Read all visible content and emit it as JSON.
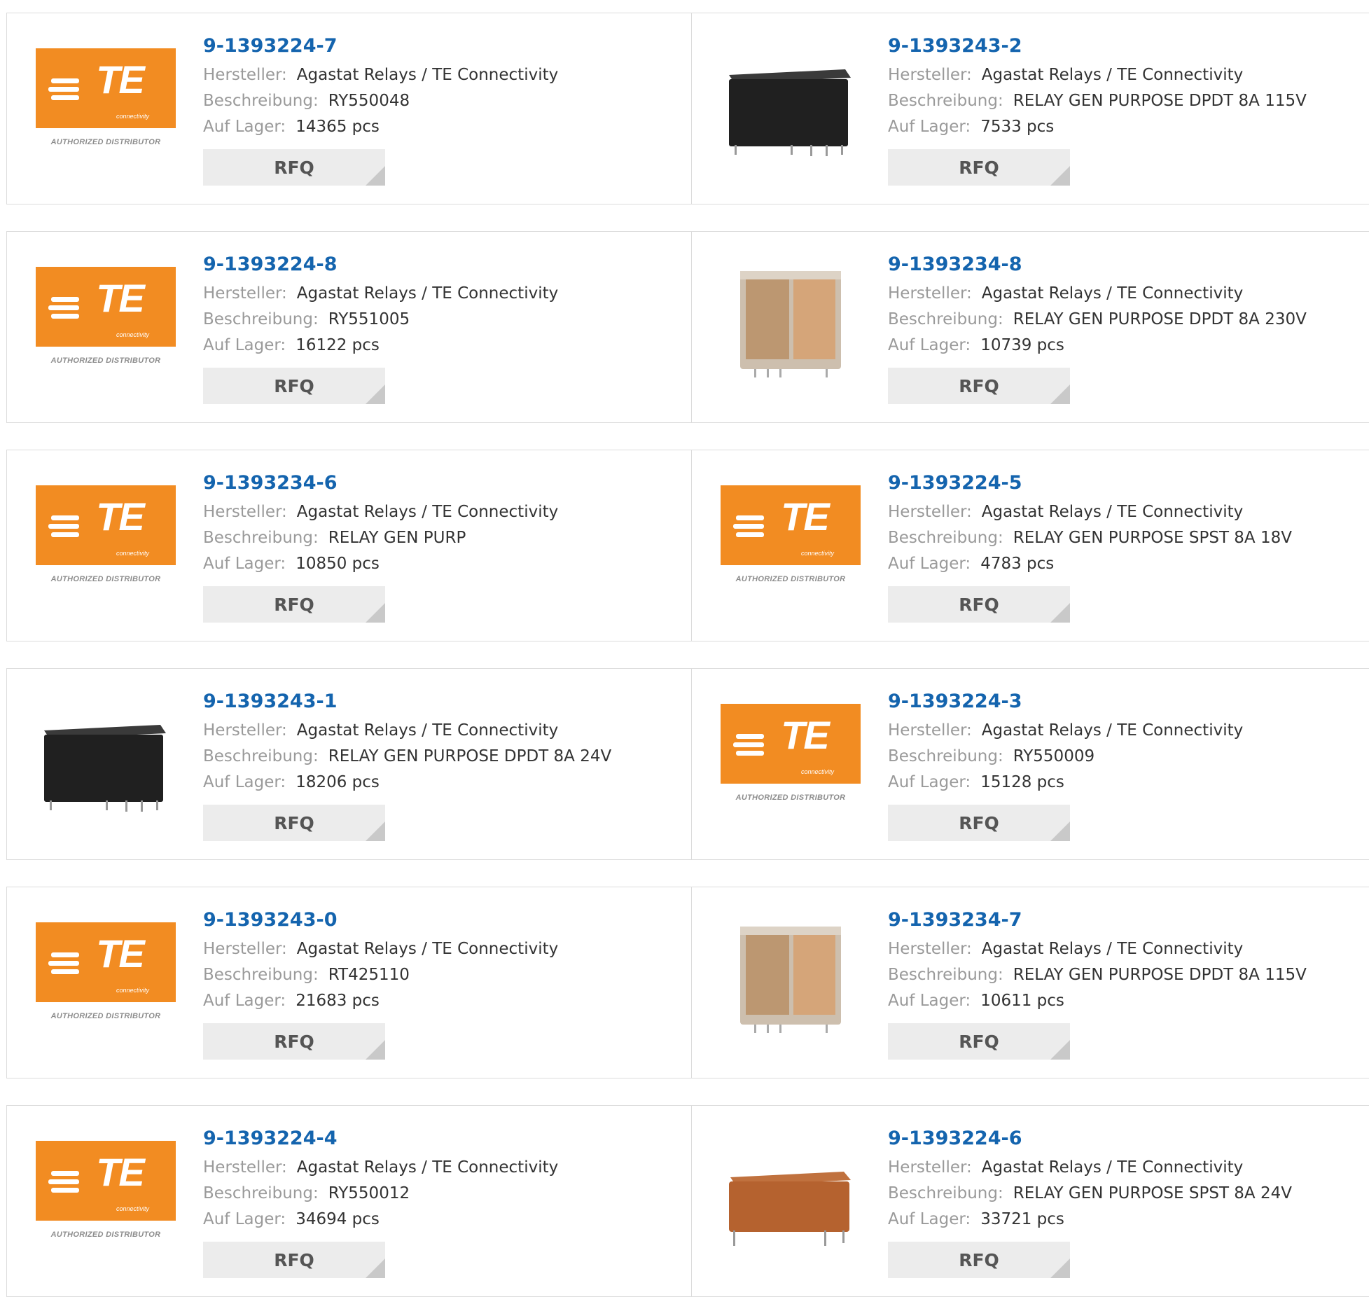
{
  "labels": {
    "manufacturer": "Hersteller:",
    "description": "Beschreibung:",
    "stock": "Auf Lager:",
    "rfq": "RFQ"
  },
  "logo": {
    "brand": "TE",
    "sub": "connectivity",
    "tagline": "AUTHORIZED DISTRIBUTOR",
    "color": "#f28c22"
  },
  "link_color": "#1464ae",
  "products": [
    {
      "pn": "9-1393224-7",
      "manufacturer": "Agastat Relays / TE Connectivity",
      "description": "RY550048",
      "stock": "14365 pcs",
      "image": "te-logo"
    },
    {
      "pn": "9-1393243-2",
      "manufacturer": "Agastat Relays / TE Connectivity",
      "description": "RELAY GEN PURPOSE DPDT 8A 115V",
      "stock": "7533 pcs",
      "image": "black-relay"
    },
    {
      "pn": "9-1393224-8",
      "manufacturer": "Agastat Relays / TE Connectivity",
      "description": "RY551005",
      "stock": "16122 pcs",
      "image": "te-logo"
    },
    {
      "pn": "9-1393234-8",
      "manufacturer": "Agastat Relays / TE Connectivity",
      "description": "RELAY GEN PURPOSE DPDT 8A 230V",
      "stock": "10739 pcs",
      "image": "clear-relay"
    },
    {
      "pn": "9-1393234-6",
      "manufacturer": "Agastat Relays / TE Connectivity",
      "description": "RELAY GEN PURP",
      "stock": "10850 pcs",
      "image": "te-logo"
    },
    {
      "pn": "9-1393224-5",
      "manufacturer": "Agastat Relays / TE Connectivity",
      "description": "RELAY GEN PURPOSE SPST 8A 18V",
      "stock": "4783 pcs",
      "image": "te-logo"
    },
    {
      "pn": "9-1393243-1",
      "manufacturer": "Agastat Relays / TE Connectivity",
      "description": "RELAY GEN PURPOSE DPDT 8A 24V",
      "stock": "18206 pcs",
      "image": "black-relay"
    },
    {
      "pn": "9-1393224-3",
      "manufacturer": "Agastat Relays / TE Connectivity",
      "description": "RY550009",
      "stock": "15128 pcs",
      "image": "te-logo"
    },
    {
      "pn": "9-1393243-0",
      "manufacturer": "Agastat Relays / TE Connectivity",
      "description": "RT425110",
      "stock": "21683 pcs",
      "image": "te-logo"
    },
    {
      "pn": "9-1393234-7",
      "manufacturer": "Agastat Relays / TE Connectivity",
      "description": "RELAY GEN PURPOSE DPDT 8A 115V",
      "stock": "10611 pcs",
      "image": "clear-relay"
    },
    {
      "pn": "9-1393224-4",
      "manufacturer": "Agastat Relays / TE Connectivity",
      "description": "RY550012",
      "stock": "34694 pcs",
      "image": "te-logo"
    },
    {
      "pn": "9-1393224-6",
      "manufacturer": "Agastat Relays / TE Connectivity",
      "description": "RELAY GEN PURPOSE SPST 8A 24V",
      "stock": "33721 pcs",
      "image": "brown-relay"
    }
  ]
}
